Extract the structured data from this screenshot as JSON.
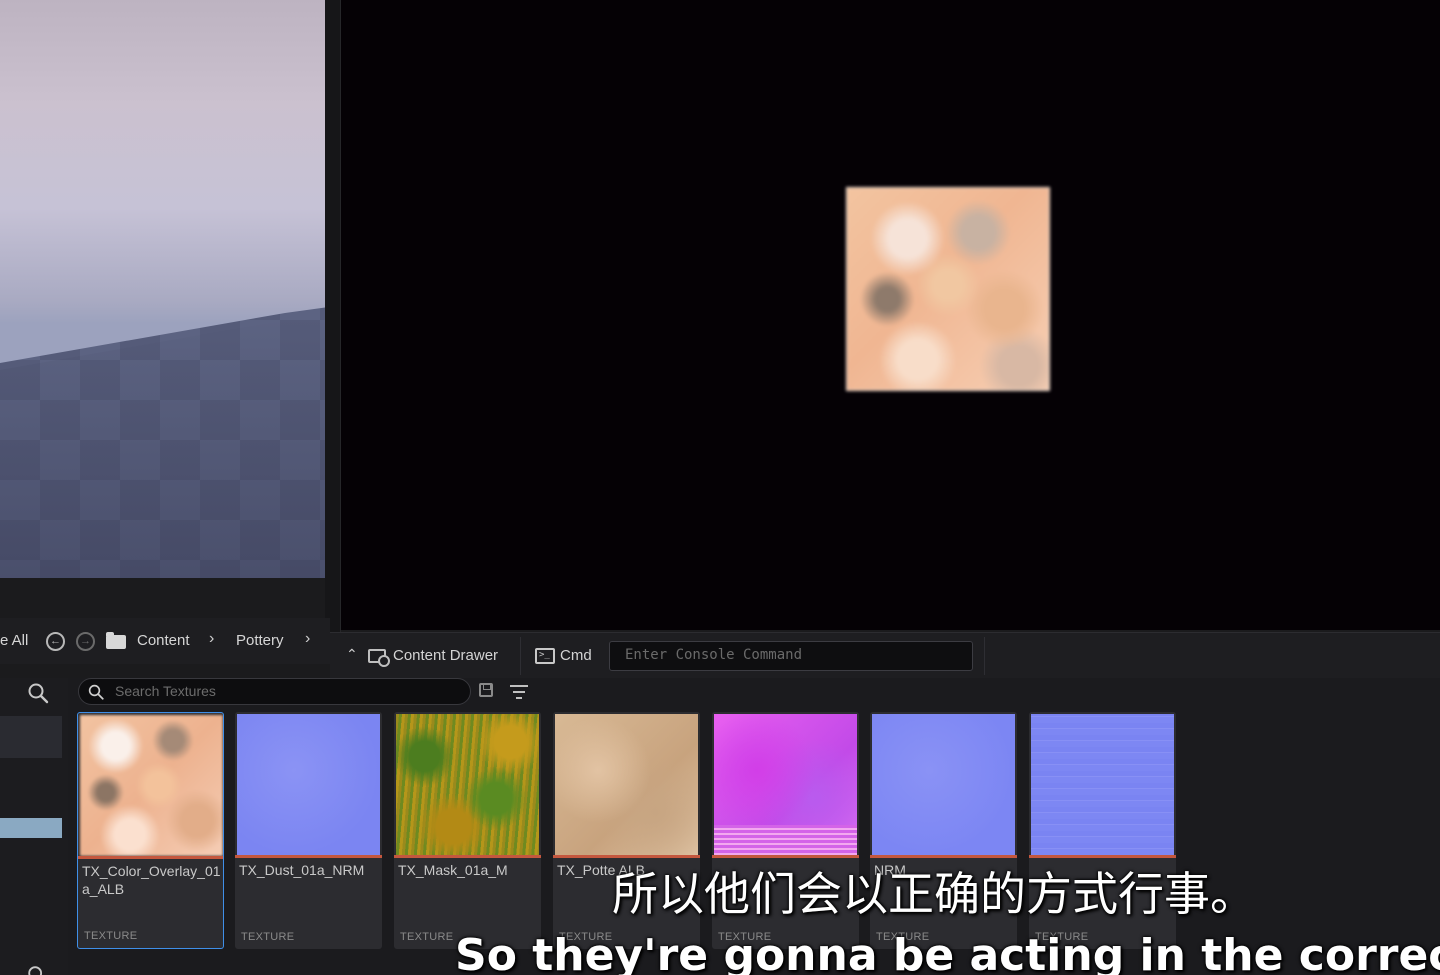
{
  "nav": {
    "all_label": "e All",
    "breadcrumbs": [
      "Content",
      "Pottery"
    ]
  },
  "statusbar": {
    "content_drawer_label": "Content Drawer",
    "cmd_label": "Cmd",
    "console_placeholder": "Enter Console Command"
  },
  "browser": {
    "search_placeholder": "Search Textures",
    "assets": [
      {
        "name": "TX_Color_Overlay_01a_ALB",
        "type": "TEXTURE",
        "selected": true
      },
      {
        "name": "TX_Dust_01a_NRM",
        "type": "TEXTURE"
      },
      {
        "name": "TX_Mask_01a_M",
        "type": "TEXTURE"
      },
      {
        "name": "TX_Potte ALB",
        "type": "TEXTURE"
      },
      {
        "name": "",
        "type": "TEXTURE"
      },
      {
        "name": "NRM",
        "type": "TEXTURE"
      },
      {
        "name": "",
        "type": "TEXTURE"
      }
    ]
  },
  "subtitles": {
    "chinese": "所以他们会以正确的方式行事。",
    "english": "So they're gonna be acting in the correct way"
  },
  "icons": {
    "back": "back-arrow-icon",
    "forward": "forward-arrow-icon",
    "folder": "folder-icon",
    "search": "search-icon",
    "save": "save-icon",
    "filter": "filter-icon",
    "cmd": "terminal-icon"
  },
  "colors": {
    "selection": "#3f8fe8",
    "texture_underline": "#c4573e"
  }
}
